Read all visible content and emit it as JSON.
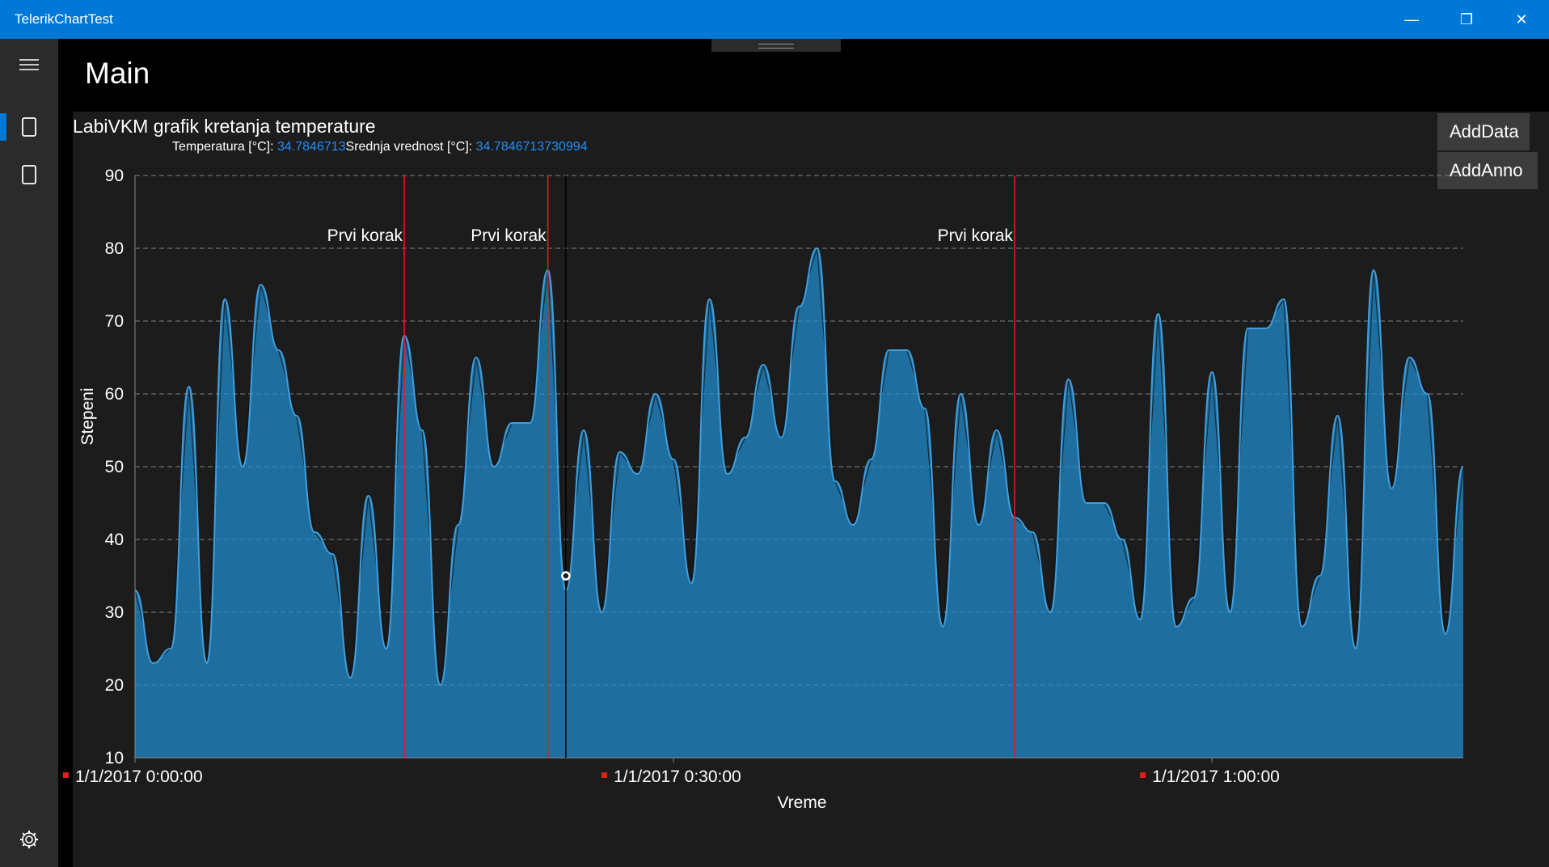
{
  "window": {
    "title": "TelerikChartTest"
  },
  "window_controls": {
    "minimize": "—",
    "restore": "❐",
    "close": "✕"
  },
  "nav": {
    "items": [
      "menu-icon",
      "page-icon",
      "page-icon",
      "settings-icon"
    ]
  },
  "page": {
    "title": "Main"
  },
  "buttons": {
    "add_data": "AddData",
    "add_anno": "AddAnno"
  },
  "stats": {
    "temp_label": "Temperatura [°C]: ",
    "temp_value": "34.7846713",
    "mean_label": "Srednja vrednost [°C]: ",
    "mean_value": "34.7846713730994"
  },
  "colors": {
    "accent": "#0078d7",
    "area": "#1f73a8",
    "line": "#3ea0e0",
    "annotation": "#e0201b",
    "value_text": "#1e90ff"
  },
  "chart_data": {
    "type": "area",
    "title": "LabiVKM grafik kretanja temperature",
    "xlabel": "Vreme",
    "ylabel": "Stepeni",
    "ylim": [
      10,
      90
    ],
    "yticks": [
      10,
      20,
      30,
      40,
      50,
      60,
      70,
      80,
      90
    ],
    "x_ticks": [
      "1/1/2017 0:00:00",
      "1/1/2017 0:30:00",
      "1/1/2017 1:00:00"
    ],
    "xlim_minutes": [
      0,
      74
    ],
    "grid": true,
    "series": [
      {
        "minutes": [
          0,
          1,
          2,
          3,
          4,
          5,
          6,
          7,
          8,
          9,
          10,
          11,
          12,
          13,
          14,
          15,
          16,
          17,
          18,
          19,
          20,
          21,
          22,
          23,
          24,
          25,
          26,
          27,
          28,
          29,
          30,
          31,
          32,
          33,
          34,
          35,
          36,
          37,
          38,
          39,
          40,
          41,
          42,
          43,
          44,
          45,
          46,
          47,
          48,
          49,
          50,
          51,
          52,
          53,
          54,
          55,
          56,
          57,
          58,
          59,
          60,
          61,
          62,
          63,
          64,
          65,
          66,
          67,
          68,
          69,
          70,
          71,
          72,
          73,
          74
        ],
        "values": [
          33,
          23,
          25,
          61,
          23,
          73,
          50,
          75,
          66,
          57,
          41,
          38,
          21,
          46,
          25,
          68,
          55,
          20,
          42,
          65,
          50,
          56,
          56,
          77,
          33,
          55,
          30,
          52,
          49,
          60,
          51,
          34,
          73,
          49,
          54,
          64,
          54,
          72,
          80,
          48,
          42,
          51,
          66,
          66,
          58,
          28,
          60,
          42,
          55,
          43,
          41,
          30,
          62,
          45,
          45,
          40,
          29,
          71,
          28,
          32,
          63,
          30,
          69,
          69,
          73,
          28,
          35,
          57,
          25,
          77,
          47,
          65,
          60,
          27,
          50
        ],
        "cursor_value": 35
      }
    ],
    "annotations": [
      {
        "label": "Prvi korak",
        "x_minutes": 15
      },
      {
        "label": "Prvi korak",
        "x_minutes": 23
      },
      {
        "label": "Prvi korak",
        "x_minutes": 49
      }
    ],
    "cursor_x_minutes": 24
  }
}
